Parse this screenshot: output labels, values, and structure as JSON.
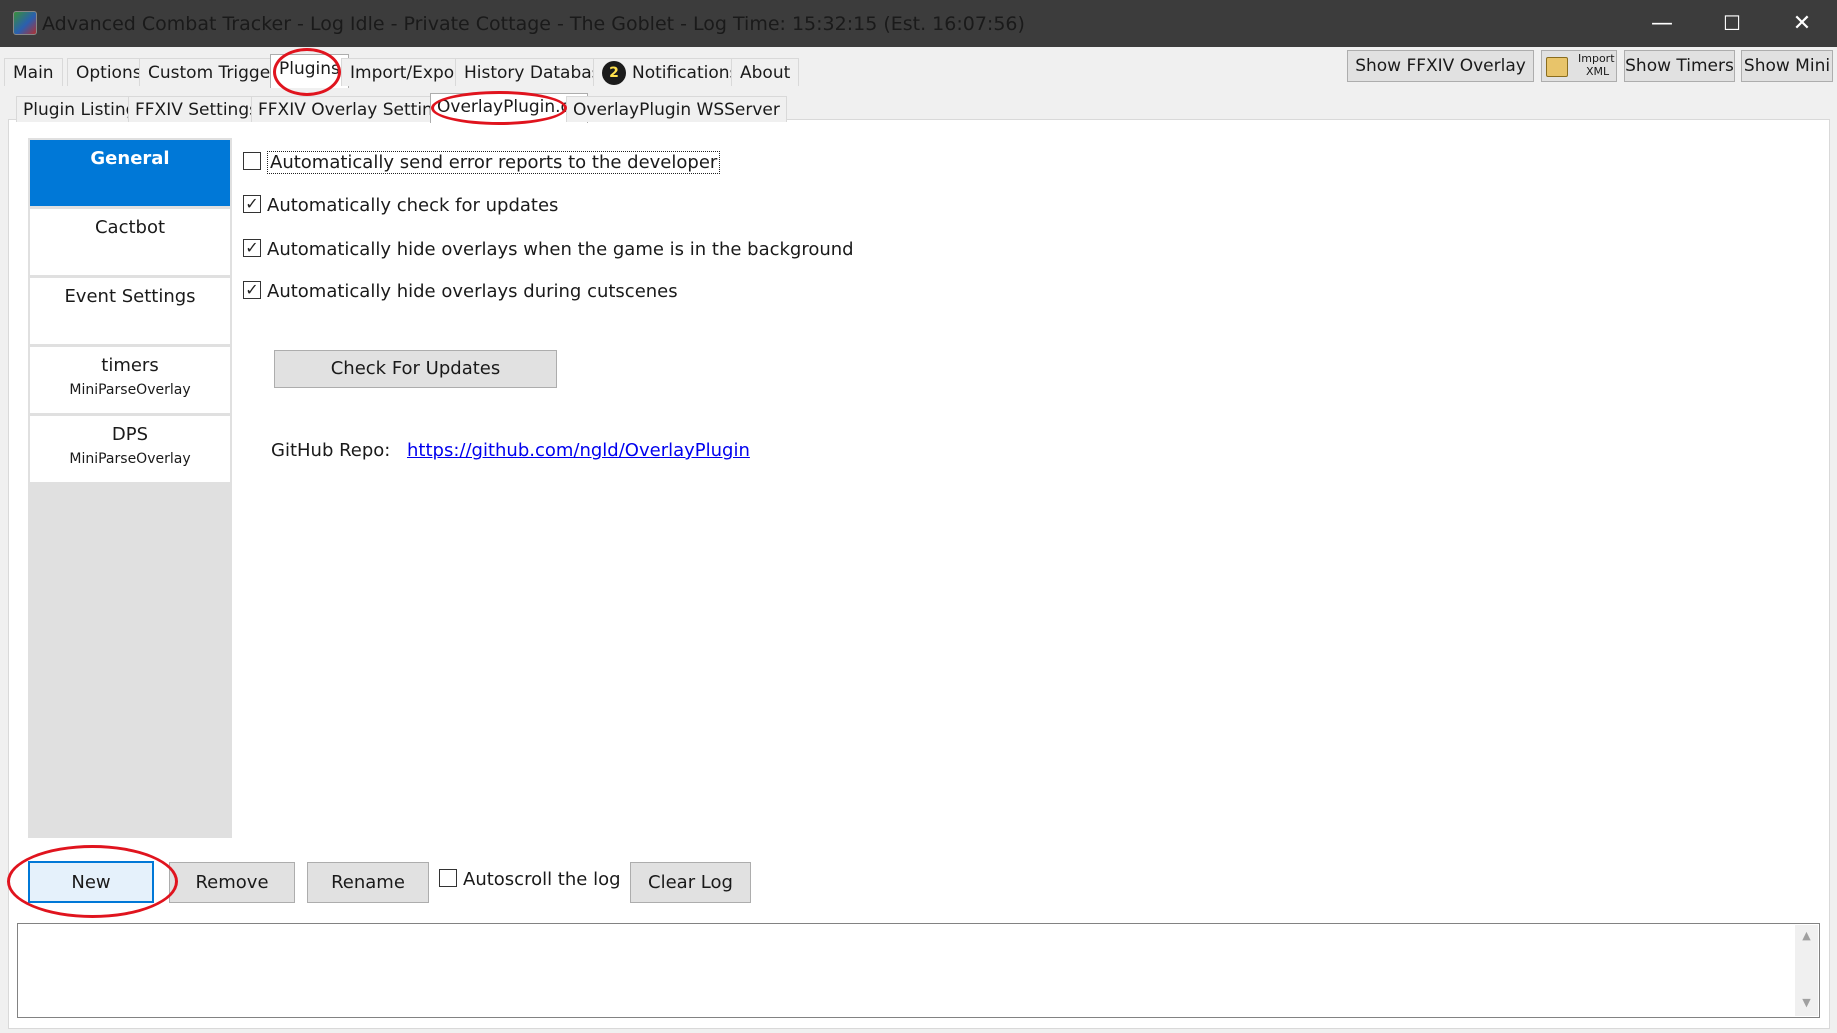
{
  "window": {
    "title": "Advanced Combat Tracker - Log Idle - Private Cottage - The Goblet - Log Time: 15:32:15 (Est. 16:07:56)",
    "controls": {
      "minimize": "—",
      "maximize": "☐",
      "close": "✕"
    }
  },
  "main_tabs": [
    "Main",
    "Options",
    "Custom Triggers",
    "Plugins",
    "Import/Export",
    "History Database",
    "Notifications",
    "About"
  ],
  "notification_count": "2",
  "toolbar": {
    "show_ffxiv_overlay": "Show FFXIV Overlay",
    "import_xml_line1": "Import",
    "import_xml_line2": "XML",
    "show_timers": "Show Timers",
    "show_mini": "Show Mini"
  },
  "sub_tabs": [
    "Plugin Listing",
    "FFXIV Settings",
    "FFXIV Overlay Settings",
    "OverlayPlugin.dll",
    "OverlayPlugin WSServer"
  ],
  "overlays": [
    {
      "name": "General",
      "type": ""
    },
    {
      "name": "Cactbot",
      "type": ""
    },
    {
      "name": "Event Settings",
      "type": ""
    },
    {
      "name": "timers",
      "type": "MiniParseOverlay"
    },
    {
      "name": "DPS",
      "type": "MiniParseOverlay"
    }
  ],
  "settings": {
    "error_reports": {
      "label": "Automatically send error reports to the developer",
      "checked": false
    },
    "check_updates": {
      "label": "Automatically check for updates",
      "checked": true
    },
    "hide_background": {
      "label": "Automatically hide overlays when the game is in the background",
      "checked": true
    },
    "hide_cutscenes": {
      "label": "Automatically hide overlays during cutscenes",
      "checked": true
    },
    "check_button": "Check For Updates",
    "github_label": "GitHub Repo:",
    "github_url": "https://github.com/ngld/OverlayPlugin"
  },
  "bottom": {
    "new": "New",
    "remove": "Remove",
    "rename": "Rename",
    "autoscroll": {
      "label": "Autoscroll the log",
      "checked": false
    },
    "clear_log": "Clear Log"
  },
  "log": {
    "text": ""
  },
  "colors": {
    "selected": "#0078d7",
    "annotation": "#e0141e",
    "titlebar": "#3c3c3c"
  }
}
